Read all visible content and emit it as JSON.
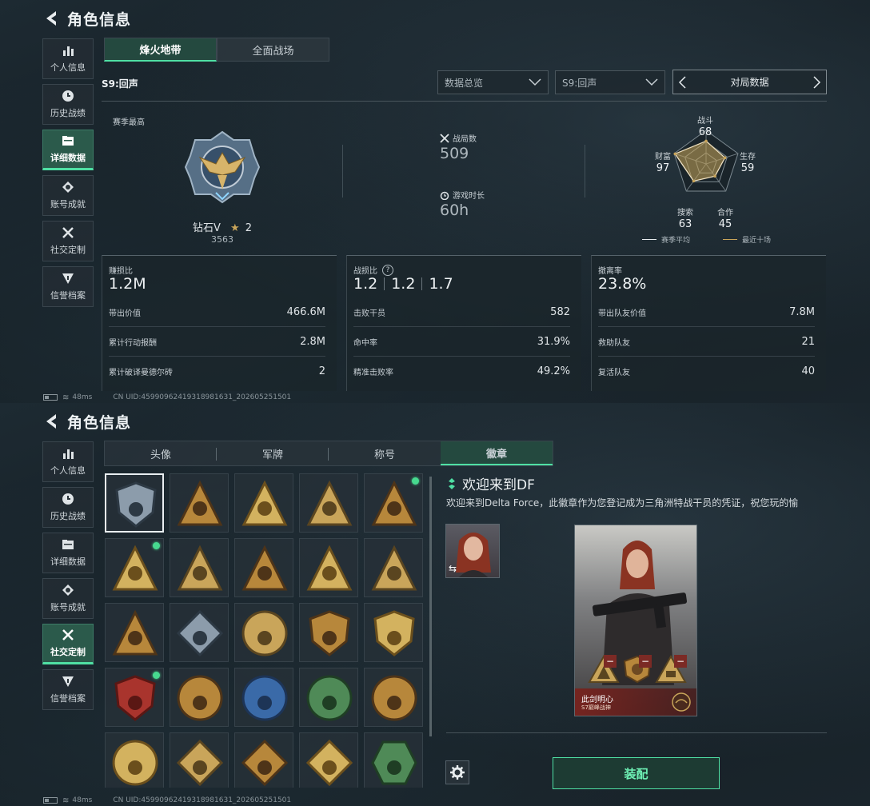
{
  "colors": {
    "accent": "#4fe0a4",
    "gold": "#c9a55a",
    "online_dot": "#47d98f",
    "equip_text": "#6ff2b6"
  },
  "header": {
    "title": "角色信息"
  },
  "nav": {
    "items": [
      {
        "label": "个人信息",
        "icon": "bar-chart-icon"
      },
      {
        "label": "历史战绩",
        "icon": "clock-icon"
      },
      {
        "label": "详细数据",
        "icon": "folder-icon"
      },
      {
        "label": "账号成就",
        "icon": "achievement-icon"
      },
      {
        "label": "社交定制",
        "icon": "tools-icon"
      },
      {
        "label": "信誉档案",
        "icon": "credit-shield-icon"
      }
    ]
  },
  "status": {
    "ping": "48ms",
    "uid": "CN UID:45990962419318981631_202605251501"
  },
  "screen1": {
    "active_nav": "详细数据",
    "tabs": [
      "烽火地带",
      "全面战场"
    ],
    "season": "S9:回声",
    "dropdowns": {
      "overview": "数据总览",
      "season": "S9:回声"
    },
    "pager": {
      "label": "对局数据"
    },
    "season_best_label": "赛季最高",
    "rank": {
      "name": "钻石V",
      "stars": "2",
      "score": "3563"
    },
    "battles": {
      "label": "战局数",
      "value": "509"
    },
    "playtime": {
      "label": "游戏时长",
      "value": "60h"
    },
    "radar": {
      "axes": [
        {
          "label": "战斗",
          "value": 68
        },
        {
          "label": "生存",
          "value": 59
        },
        {
          "label": "合作",
          "value": 45
        },
        {
          "label": "搜索",
          "value": 63
        },
        {
          "label": "财富",
          "value": 97
        }
      ],
      "legend": [
        "赛季平均",
        "最近十场"
      ]
    },
    "cards": [
      {
        "title": "赚损比",
        "big": "1.2M",
        "rows": [
          {
            "label": "带出价值",
            "value": "466.6M"
          },
          {
            "label": "累计行动报酬",
            "value": "2.8M"
          },
          {
            "label": "累计破译曼德尔砖",
            "value": "2"
          }
        ]
      },
      {
        "title": "战损比",
        "big_values": [
          "1.2",
          "1.2",
          "1.7"
        ],
        "rows": [
          {
            "label": "击败干员",
            "value": "582"
          },
          {
            "label": "命中率",
            "value": "31.9%"
          },
          {
            "label": "精准击败率",
            "value": "49.2%"
          }
        ]
      },
      {
        "title": "撤离率",
        "big": "23.8%",
        "rows": [
          {
            "label": "带出队友价值",
            "value": "7.8M"
          },
          {
            "label": "救助队友",
            "value": "21"
          },
          {
            "label": "复活队友",
            "value": "40"
          }
        ]
      }
    ]
  },
  "screen2": {
    "active_nav": "社交定制",
    "tabs": [
      "头像",
      "军牌",
      "称号",
      "徽章"
    ],
    "badges": [
      {
        "icon": "delta-shield-badge-icon",
        "selected": true,
        "dot": false
      },
      {
        "icon": "helicopter-badge-icon",
        "selected": false,
        "dot": false
      },
      {
        "icon": "s4-badge-icon",
        "selected": false,
        "dot": false
      },
      {
        "icon": "s7-badge-icon",
        "selected": false,
        "dot": false
      },
      {
        "icon": "tank-badge-icon",
        "selected": false,
        "dot": true
      },
      {
        "icon": "operator-badge-icon",
        "selected": false,
        "dot": true
      },
      {
        "icon": "eri-badge-icon",
        "selected": false,
        "dot": false
      },
      {
        "icon": "hands-badge-icon",
        "selected": false,
        "dot": false
      },
      {
        "icon": "number-one-badge-icon",
        "selected": false,
        "dot": false
      },
      {
        "icon": "lighter-badge-icon",
        "selected": false,
        "dot": false
      },
      {
        "icon": "squad-badge-icon",
        "selected": false,
        "dot": false
      },
      {
        "icon": "rose-badge-icon",
        "selected": false,
        "dot": false
      },
      {
        "icon": "star-wreath-badge-icon",
        "selected": false,
        "dot": false
      },
      {
        "icon": "gold-shield-badge-icon",
        "selected": false,
        "dot": false
      },
      {
        "icon": "winged-shield-badge-icon",
        "selected": false,
        "dot": false
      },
      {
        "icon": "crest-badge-icon",
        "selected": false,
        "dot": true
      },
      {
        "icon": "round-gold-badge-icon",
        "selected": false,
        "dot": false
      },
      {
        "icon": "crosshair-blue-badge-icon",
        "selected": false,
        "dot": false
      },
      {
        "icon": "crosshair-green-badge-icon",
        "selected": false,
        "dot": false
      },
      {
        "icon": "round-bronze-badge-icon",
        "selected": false,
        "dot": false
      },
      {
        "icon": "target-gold-badge-icon",
        "selected": false,
        "dot": false
      },
      {
        "icon": "wolf-badge-icon",
        "selected": false,
        "dot": false
      },
      {
        "icon": "wolf-bronze-badge-icon",
        "selected": false,
        "dot": false
      },
      {
        "icon": "boot-badge-icon",
        "selected": false,
        "dot": false
      },
      {
        "icon": "green-hex-badge-icon",
        "selected": false,
        "dot": false
      }
    ],
    "detail": {
      "title": "欢迎来到DF",
      "desc": "欢迎来到Delta Force，此徽章作为您登记成为三角洲特战干员的凭证，祝您玩的愉"
    },
    "card": {
      "name": "此剑明心",
      "sub": "S7巅峰战神"
    },
    "equip_label": "装配"
  }
}
